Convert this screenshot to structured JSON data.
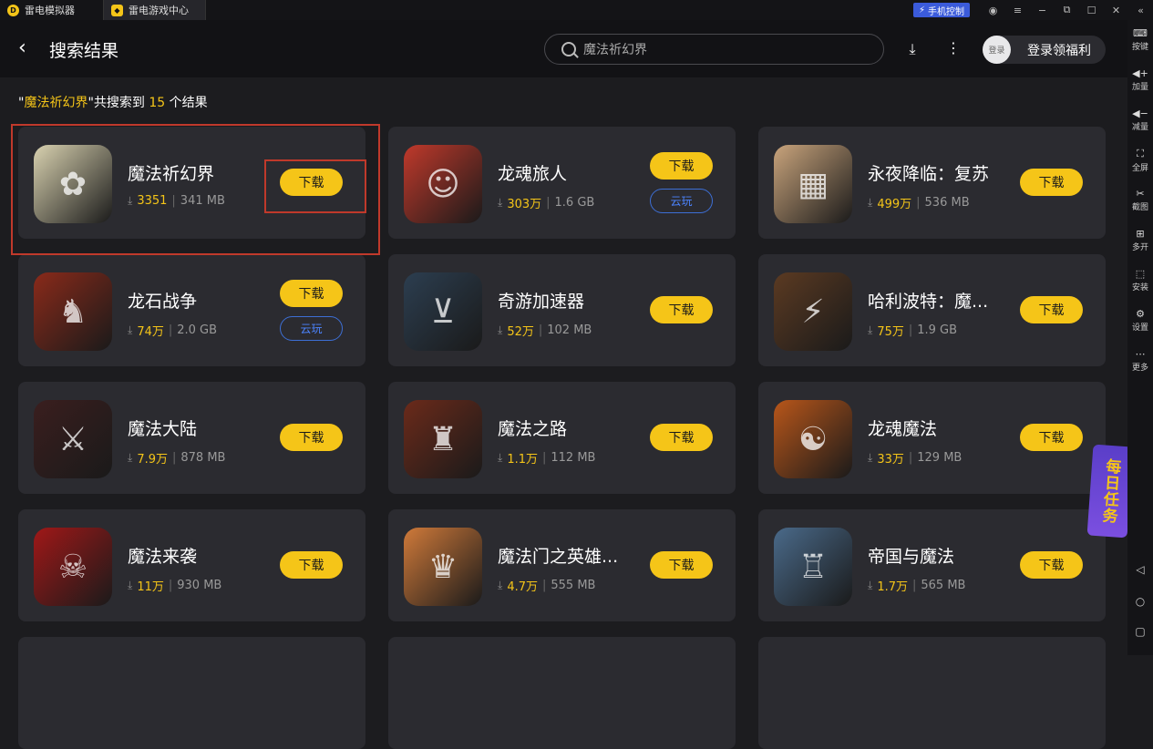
{
  "titlebar": {
    "tabs": [
      {
        "label": "雷电模拟器"
      },
      {
        "label": "雷电游戏中心"
      }
    ],
    "phone_control": "手机控制"
  },
  "header": {
    "back": "‹",
    "title": "搜索结果",
    "search_value": "魔法祈幻界",
    "login_avatar": "登录",
    "login_label": "登录领福利"
  },
  "result": {
    "quote_open": "\"",
    "query": "魔法祈幻界",
    "quote_close": "\"",
    "prefix": "共搜索到",
    "count": "15",
    "suffix": "个结果"
  },
  "download_label": "下载",
  "cloud_label": "云玩",
  "apps": [
    {
      "name": "魔法祈幻界",
      "downloads": "3351",
      "size": "341 MB",
      "cloud": false
    },
    {
      "name": "龙魂旅人",
      "downloads": "303万",
      "size": "1.6 GB",
      "cloud": true
    },
    {
      "name": "永夜降临：复苏",
      "downloads": "499万",
      "size": "536 MB",
      "cloud": false
    },
    {
      "name": "龙石战争",
      "downloads": "74万",
      "size": "2.0 GB",
      "cloud": true
    },
    {
      "name": "奇游加速器",
      "downloads": "52万",
      "size": "102 MB",
      "cloud": false
    },
    {
      "name": "哈利波特：魔...",
      "downloads": "75万",
      "size": "1.9 GB",
      "cloud": false
    },
    {
      "name": "魔法大陆",
      "downloads": "7.9万",
      "size": "878 MB",
      "cloud": false
    },
    {
      "name": "魔法之路",
      "downloads": "1.1万",
      "size": "112 MB",
      "cloud": false
    },
    {
      "name": "龙魂魔法",
      "downloads": "33万",
      "size": "129 MB",
      "cloud": false
    },
    {
      "name": "魔法来袭",
      "downloads": "11万",
      "size": "930 MB",
      "cloud": false
    },
    {
      "name": "魔法门之英雄...",
      "downloads": "4.7万",
      "size": "555 MB",
      "cloud": false
    },
    {
      "name": "帝国与魔法",
      "downloads": "1.7万",
      "size": "565 MB",
      "cloud": false
    }
  ],
  "sidebar": [
    {
      "label": "按键",
      "icon": "keyboard-icon"
    },
    {
      "label": "加量",
      "icon": "volume-up-icon"
    },
    {
      "label": "减量",
      "icon": "volume-down-icon"
    },
    {
      "label": "全屏",
      "icon": "fullscreen-icon"
    },
    {
      "label": "截图",
      "icon": "scissors-icon"
    },
    {
      "label": "多开",
      "icon": "multi-instance-icon"
    },
    {
      "label": "安装",
      "icon": "apk-icon"
    },
    {
      "label": "设置",
      "icon": "gear-icon"
    },
    {
      "label": "更多",
      "icon": "more-icon"
    }
  ],
  "daily_task": "每日任务",
  "icon_colors": [
    "#d9d2b0",
    "#c0392b",
    "#c9a47c",
    "#8a2a1a",
    "#2c3e50",
    "#5b3a22",
    "#3a1e1e",
    "#6b2a1a",
    "#b8561a",
    "#a01818",
    "#d07a3a",
    "#4a6a8a"
  ]
}
